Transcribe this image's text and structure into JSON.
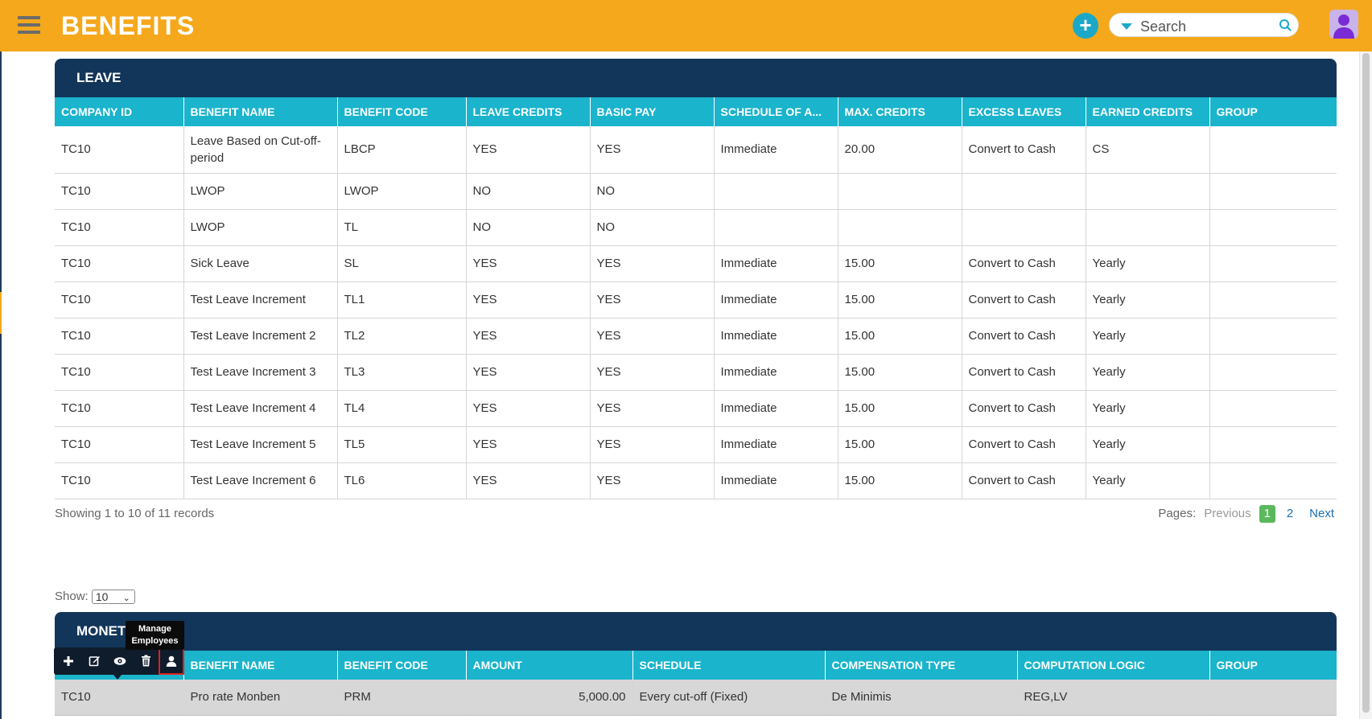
{
  "app": {
    "title": "BENEFITS",
    "search_placeholder": "Search"
  },
  "leave": {
    "title": "LEAVE",
    "columns": [
      "COMPANY ID",
      "BENEFIT NAME",
      "BENEFIT CODE",
      "LEAVE CREDITS",
      "BASIC PAY",
      "SCHEDULE OF A...",
      "MAX. CREDITS",
      "EXCESS LEAVES",
      "EARNED CREDITS",
      "GROUP"
    ],
    "rows": [
      [
        "TC10",
        "Leave Based on Cut-off-period",
        "LBCP",
        "YES",
        "YES",
        "Immediate",
        "20.00",
        "Convert to Cash",
        "CS",
        ""
      ],
      [
        "TC10",
        "LWOP",
        "LWOP",
        "NO",
        "NO",
        "",
        "",
        "",
        "",
        ""
      ],
      [
        "TC10",
        "LWOP",
        "TL",
        "NO",
        "NO",
        "",
        "",
        "",
        "",
        ""
      ],
      [
        "TC10",
        "Sick Leave",
        "SL",
        "YES",
        "YES",
        "Immediate",
        "15.00",
        "Convert to Cash",
        "Yearly",
        ""
      ],
      [
        "TC10",
        "Test Leave Increment",
        "TL1",
        "YES",
        "YES",
        "Immediate",
        "15.00",
        "Convert to Cash",
        "Yearly",
        ""
      ],
      [
        "TC10",
        "Test Leave Increment 2",
        "TL2",
        "YES",
        "YES",
        "Immediate",
        "15.00",
        "Convert to Cash",
        "Yearly",
        ""
      ],
      [
        "TC10",
        "Test Leave Increment 3",
        "TL3",
        "YES",
        "YES",
        "Immediate",
        "15.00",
        "Convert to Cash",
        "Yearly",
        ""
      ],
      [
        "TC10",
        "Test Leave Increment 4",
        "TL4",
        "YES",
        "YES",
        "Immediate",
        "15.00",
        "Convert to Cash",
        "Yearly",
        ""
      ],
      [
        "TC10",
        "Test Leave Increment 5",
        "TL5",
        "YES",
        "YES",
        "Immediate",
        "15.00",
        "Convert to Cash",
        "Yearly",
        ""
      ],
      [
        "TC10",
        "Test Leave Increment 6",
        "TL6",
        "YES",
        "YES",
        "Immediate",
        "15.00",
        "Convert to Cash",
        "Yearly",
        ""
      ]
    ],
    "records_info": "Showing 1 to 10 of 11 records",
    "pager": {
      "label": "Pages:",
      "previous": "Previous",
      "pages": [
        "1",
        "2"
      ],
      "next": "Next"
    }
  },
  "show": {
    "label": "Show:",
    "value": "10",
    "chevron": "⌄"
  },
  "monetary": {
    "title": "MONET",
    "columns": [
      "",
      "BENEFIT NAME",
      "BENEFIT CODE",
      "AMOUNT",
      "SCHEDULE",
      "COMPENSATION TYPE",
      "COMPUTATION LOGIC",
      "GROUP"
    ],
    "rows": [
      [
        "TC10",
        "Pro rate Monben",
        "PRM",
        "5,000.00",
        "Every cut-off (Fixed)",
        "De Minimis",
        "REG,LV",
        ""
      ]
    ],
    "tooltip_line1": "Manage",
    "tooltip_line2": "Employees"
  },
  "icons": {
    "menu": "hamburger-icon",
    "add": "plus-circle-icon",
    "search": "search-icon",
    "avatar": "user-avatar-icon",
    "add_row": "plus-icon",
    "edit": "edit-icon",
    "view": "eye-icon",
    "delete": "trash-icon",
    "manage": "user-icon"
  },
  "colors": {
    "topbar": "#f5a81c",
    "panel_header": "#12365a",
    "column_header": "#1ab4cc",
    "accent": "#1ba8c8",
    "page_active": "#5cb85c"
  }
}
